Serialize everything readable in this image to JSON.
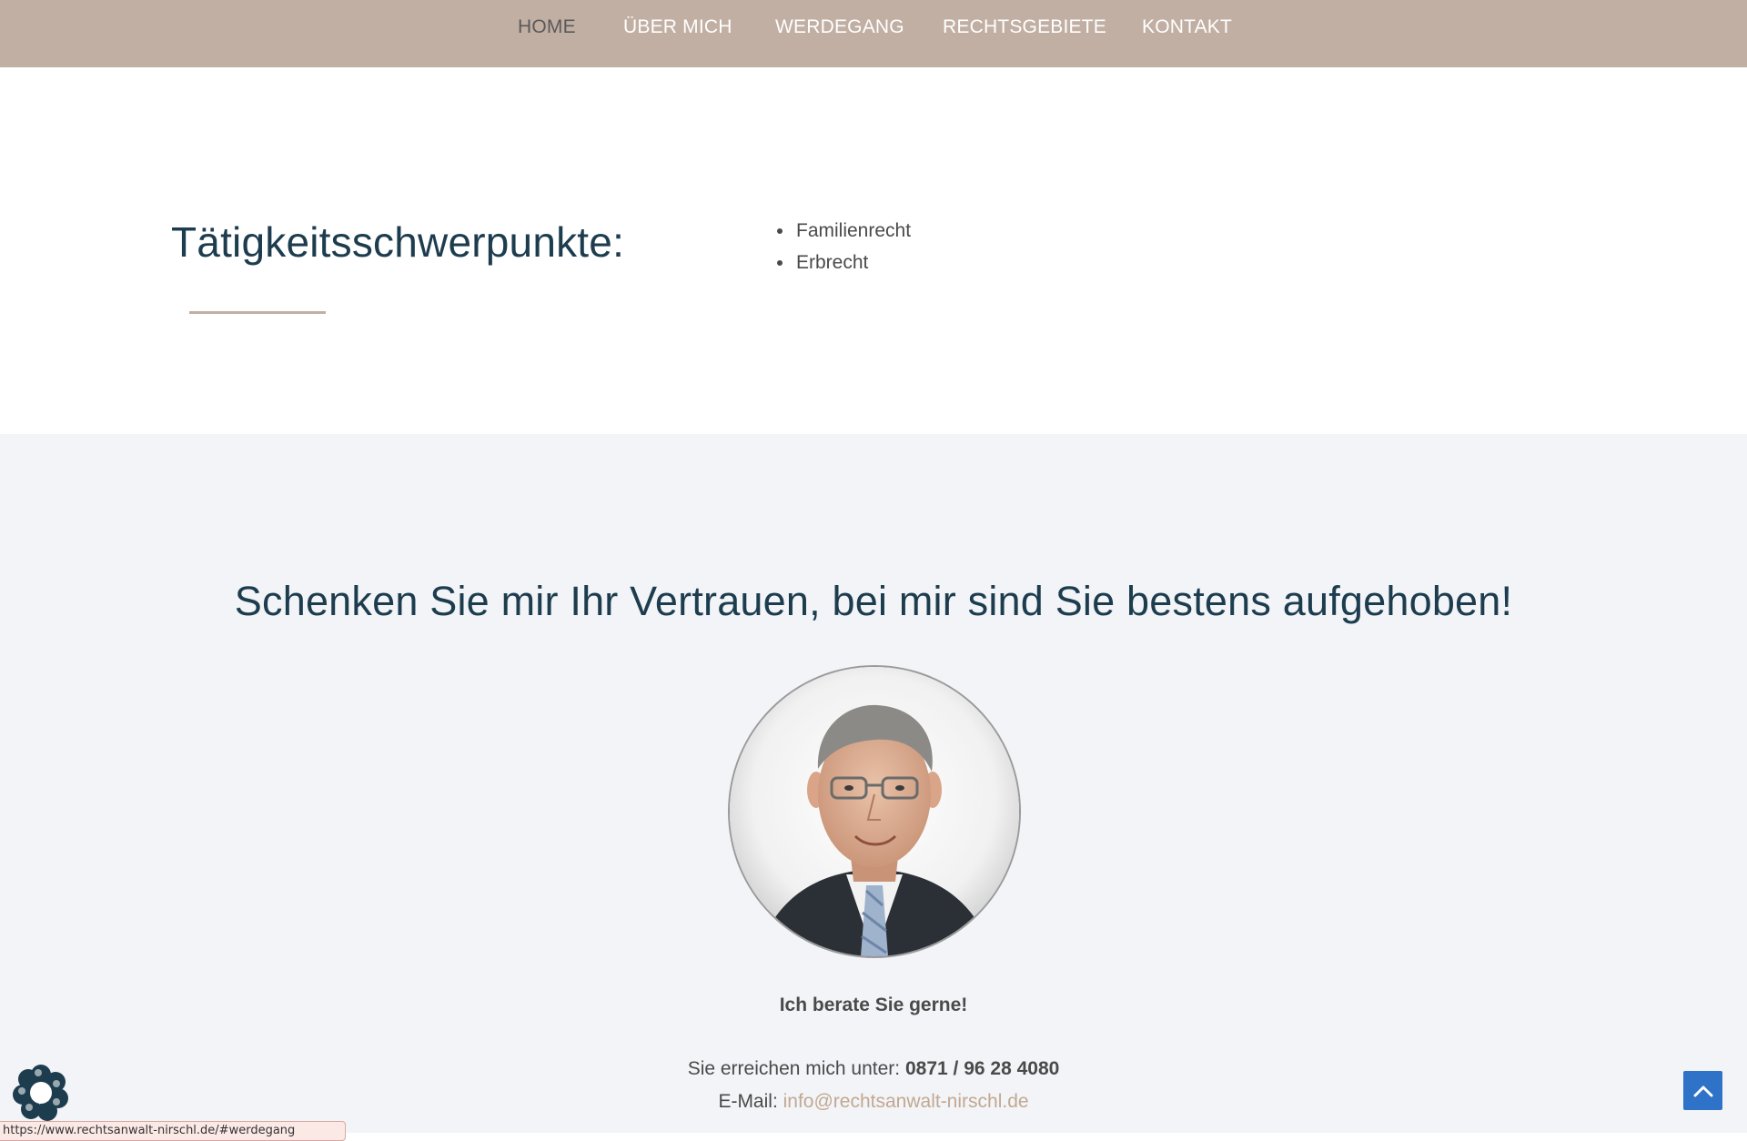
{
  "nav": {
    "items": [
      {
        "label": "HOME"
      },
      {
        "label": "ÜBER MICH"
      },
      {
        "label": "WERDEGANG"
      },
      {
        "label": "RECHTSGEBIETE"
      },
      {
        "label": "KONTAKT"
      }
    ],
    "active": "HOME"
  },
  "focus": {
    "title": "Tätigkeitsschwerpunkte:",
    "items": [
      "Familienrecht",
      "Erbrecht"
    ]
  },
  "contact": {
    "heading": "Schenken Sie mir Ihr Vertrauen, bei mir sind Sie bestens aufgehoben!",
    "consult": "Ich berate Sie gerne!",
    "reach_prefix": "Sie erreichen mich unter:",
    "phone": "0871 / 96 28 4080",
    "email_prefix": "E-Mail:",
    "email": "info@rechtsanwalt-nirschl.de"
  },
  "status_bar": {
    "url": "https://www.rechtsanwalt-nirschl.de/#werdegang"
  },
  "icons": {
    "cookie": "cookie-settings-icon",
    "scroll_top": "chevron-up-icon",
    "portrait": "portrait-photo"
  },
  "colors": {
    "nav_bg": "#c2afa3",
    "heading": "#1d3d4f",
    "accent": "#c2a892",
    "section_bg": "#f2f4f7",
    "scroll_btn": "#2f73c9"
  }
}
